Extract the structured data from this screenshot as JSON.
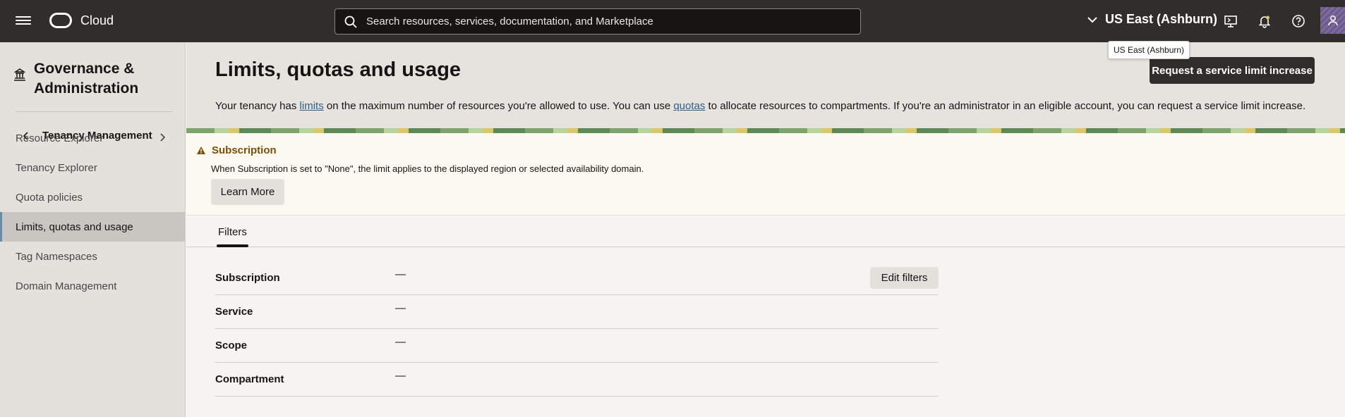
{
  "header": {
    "brand": "Cloud",
    "search_placeholder": "Search resources, services, documentation, and Marketplace",
    "region": "US East (Ashburn)",
    "region_tooltip": "US East (Ashburn)",
    "icons": [
      "menu-icon",
      "oracle-logo",
      "search-icon",
      "chevron-down-icon",
      "cloud-shell-icon",
      "bell-icon",
      "help-icon",
      "user-icon"
    ]
  },
  "sidebar": {
    "title": "Governance & Administration",
    "back_label": "Tenancy Management",
    "items": [
      {
        "label": "Resource Explorer",
        "has_chevron": true,
        "active": false
      },
      {
        "label": "Tenancy Explorer",
        "active": false
      },
      {
        "label": "Quota policies",
        "active": false
      },
      {
        "label": "Limits, quotas and usage",
        "active": true
      },
      {
        "label": "Tag Namespaces",
        "active": false
      },
      {
        "label": "Domain Management",
        "active": false
      }
    ]
  },
  "main": {
    "title": "Limits, quotas and usage",
    "request_button": "Request a service limit increase",
    "description": {
      "part1": "Your tenancy has ",
      "link1": "limits",
      "part2": " on the maximum number of resources you're allowed to use. You can use ",
      "link2": "quotas",
      "part3": " to allocate resources to compartments. If you're an administrator in an eligible account, you can request a service limit increase."
    },
    "notice": {
      "title": "Subscription",
      "body": "When Subscription is set to \"None\", the limit applies to the displayed region or selected availability domain.",
      "button": "Learn More"
    },
    "tab": "Filters",
    "edit_button": "Edit filters",
    "filters": [
      {
        "key": "Subscription",
        "value": "—"
      },
      {
        "key": "Service",
        "value": "—"
      },
      {
        "key": "Scope",
        "value": "—"
      },
      {
        "key": "Compartment",
        "value": "—"
      }
    ]
  }
}
